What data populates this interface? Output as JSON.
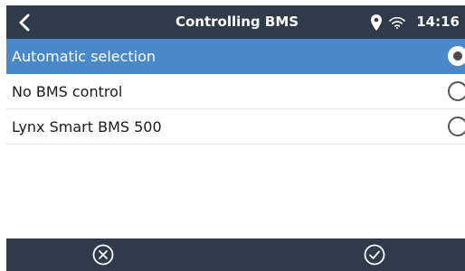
{
  "status_bar": {
    "title": "Controlling BMS",
    "time": "14:16",
    "back_icon": "chevron-left-icon",
    "location_icon": "location-pin-icon",
    "wifi_icon": "wifi-icon"
  },
  "options": [
    {
      "label": "Automatic selection",
      "selected": true
    },
    {
      "label": "No BMS control",
      "selected": false
    },
    {
      "label": "Lynx Smart BMS 500",
      "selected": false
    }
  ],
  "bottom_bar": {
    "cancel_icon": "cancel-circle-icon",
    "confirm_icon": "check-circle-icon"
  },
  "colors": {
    "bar_background": "#2f3b4a",
    "selected_row": "#4a89c9",
    "divider": "#dfe2e6"
  }
}
